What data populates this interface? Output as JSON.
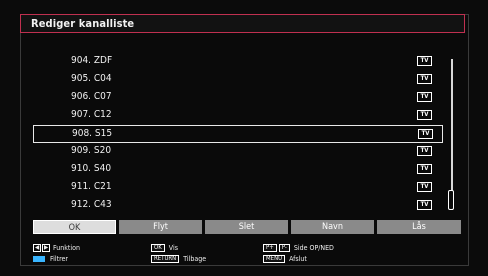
{
  "title": "Rediger kanalliste",
  "channels": [
    {
      "name": "904. ZDF",
      "type": "TV",
      "selected": false
    },
    {
      "name": "905. C04",
      "type": "TV",
      "selected": false
    },
    {
      "name": "906. C07",
      "type": "TV",
      "selected": false
    },
    {
      "name": "907. C12",
      "type": "TV",
      "selected": false
    },
    {
      "name": "908. S15",
      "type": "TV",
      "selected": true
    },
    {
      "name": "909. S20",
      "type": "TV",
      "selected": false
    },
    {
      "name": "910. S40",
      "type": "TV",
      "selected": false
    },
    {
      "name": "911. C21",
      "type": "TV",
      "selected": false
    },
    {
      "name": "912. C43",
      "type": "TV",
      "selected": false
    }
  ],
  "buttons": {
    "ok": "OK",
    "move": "Flyt",
    "delete": "Slet",
    "name": "Navn",
    "lock": "Lås"
  },
  "active_button": "OK",
  "footer": {
    "function": "Funktion",
    "filter": "Filtrer",
    "ok_key": "OK",
    "view": "Vis",
    "back_key": "RETURN",
    "back": "Tilbage",
    "page_key_plus": "P+",
    "page_key_minus": "P-",
    "page": "Side OP/NED",
    "menu_key": "MENU",
    "exit": "Afslut"
  },
  "colors": {
    "title_border": "#c03050",
    "filter_key": "#39b5ff"
  }
}
